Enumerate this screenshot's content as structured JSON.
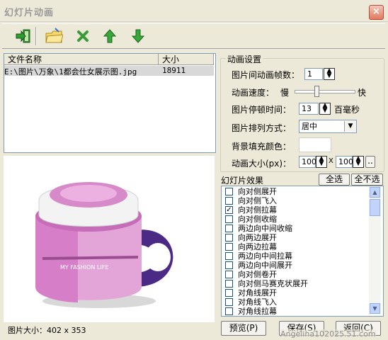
{
  "window": {
    "title": "幻灯片动画",
    "close": "×"
  },
  "toolbar": {
    "icons": [
      "exit-icon",
      "open-folder-icon",
      "delete-icon",
      "move-up-icon",
      "move-down-icon"
    ]
  },
  "filelist": {
    "columns": [
      "文件名称",
      "大小"
    ],
    "rows": [
      {
        "name": "E:\\图片\\万象\\1都会仕女展示图.jpg",
        "size": "18911"
      }
    ]
  },
  "preview": {
    "cup_text": "MY FASHION LIFE"
  },
  "anim": {
    "group_title": "动画设置",
    "frames_label": "图片间动画帧数：",
    "frames_value": "1",
    "speed_label": "动画速度：",
    "speed_slow": "慢",
    "speed_fast": "快",
    "speed_level": 0.35,
    "pause_label": "图片停顿时间：",
    "pause_value": "13",
    "pause_unit": "百毫秒",
    "arrange_label": "图片排列方式：",
    "arrange_value": "居中",
    "bg_label": "背景填充颜色：",
    "size_label": "动画大小(px)：",
    "width_value": "100",
    "x_sep": "X",
    "height_value": "100",
    "more_btn": ".."
  },
  "effects": {
    "group_title": "幻灯片效果",
    "select_all": "全选",
    "select_none": "全不选",
    "items": [
      {
        "label": "向对侧展开",
        "checked": false
      },
      {
        "label": "向对侧飞入",
        "checked": false
      },
      {
        "label": "向对侧拉幕",
        "checked": true
      },
      {
        "label": "向对侧收缩",
        "checked": false
      },
      {
        "label": "两边向中间收缩",
        "checked": false
      },
      {
        "label": "向两边展开",
        "checked": false
      },
      {
        "label": "向两边拉幕",
        "checked": false
      },
      {
        "label": "两边向中间拉幕",
        "checked": false
      },
      {
        "label": "两边向中间展开",
        "checked": false
      },
      {
        "label": "向对侧卷开",
        "checked": false
      },
      {
        "label": "向对侧马赛克状展开",
        "checked": false
      },
      {
        "label": "对角线展开",
        "checked": false
      },
      {
        "label": "对角线飞入",
        "checked": false
      },
      {
        "label": "对角线拉幕",
        "checked": false
      }
    ]
  },
  "status": {
    "image_size": "图片大小：402 x 353"
  },
  "buttons": {
    "preview": "预览(P)",
    "save": "保存(S)",
    "back": "返回(C)"
  },
  "watermark": "Angelina102025.51.com"
}
